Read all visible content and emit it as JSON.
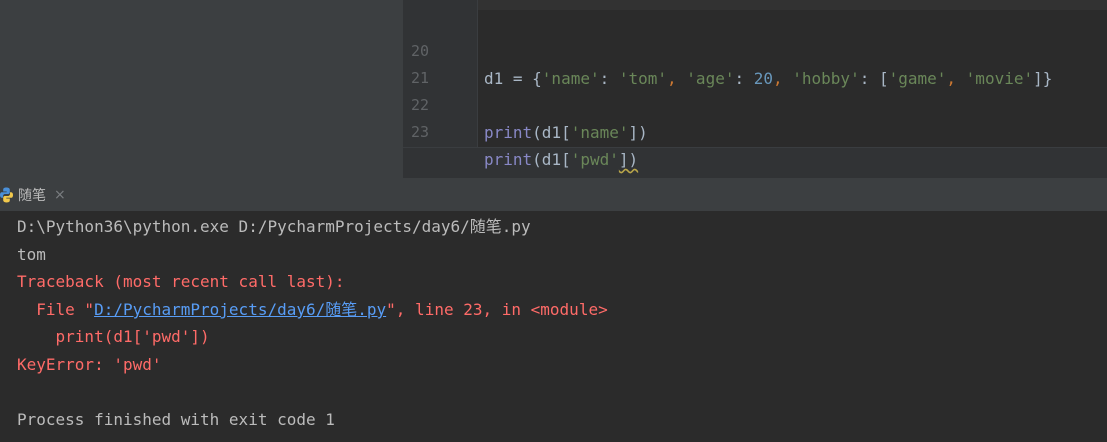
{
  "editor": {
    "lines": [
      {
        "num": "20",
        "tokens": [
          {
            "t": "d1 = {",
            "c": "plain"
          },
          {
            "t": "'name'",
            "c": "str"
          },
          {
            "t": ": ",
            "c": "plain"
          },
          {
            "t": "'tom'",
            "c": "str"
          },
          {
            "t": ", ",
            "c": "punc"
          },
          {
            "t": "'age'",
            "c": "str"
          },
          {
            "t": ": ",
            "c": "plain"
          },
          {
            "t": "20",
            "c": "num"
          },
          {
            "t": ", ",
            "c": "punc"
          },
          {
            "t": "'hobby'",
            "c": "str"
          },
          {
            "t": ": [",
            "c": "plain"
          },
          {
            "t": "'game'",
            "c": "str"
          },
          {
            "t": ", ",
            "c": "punc"
          },
          {
            "t": "'movie'",
            "c": "str"
          },
          {
            "t": "]}",
            "c": "plain"
          }
        ]
      },
      {
        "num": "21",
        "tokens": []
      },
      {
        "num": "22",
        "tokens": [
          {
            "t": "print",
            "c": "kw"
          },
          {
            "t": "(d1[",
            "c": "plain"
          },
          {
            "t": "'name'",
            "c": "str"
          },
          {
            "t": "])",
            "c": "plain"
          }
        ]
      },
      {
        "num": "23",
        "tokens": [
          {
            "t": "print",
            "c": "kw"
          },
          {
            "t": "(d1[",
            "c": "plain"
          },
          {
            "t": "'pwd'",
            "c": "str"
          },
          {
            "t": "])",
            "c": "plain",
            "squiggle": true
          }
        ]
      }
    ]
  },
  "run": {
    "tab_label": "随笔",
    "close_glyph": "×",
    "output": {
      "command": "D:\\Python36\\python.exe D:/PycharmProjects/day6/随笔.py",
      "stdout_1": "tom",
      "traceback_head": "Traceback (most recent call last):",
      "file_prefix": "  File \"",
      "file_link": "D:/PycharmProjects/day6/随笔.py",
      "file_suffix": "\", line 23, in <module>",
      "code_echo": "    print(d1['pwd'])",
      "error": "KeyError: 'pwd'",
      "exit_message": "Process finished with exit code 1"
    }
  },
  "colors": {
    "string": "#6a8759",
    "number": "#6897bb",
    "keyword": "#8888c6",
    "punctuation": "#cc7832",
    "error": "#ff6b68",
    "link": "#589df6"
  }
}
